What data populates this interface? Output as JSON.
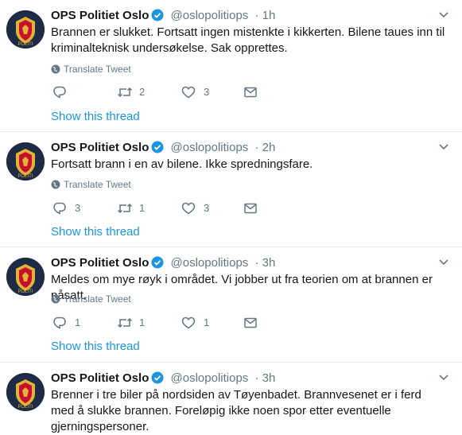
{
  "tweets": [
    {
      "name": "OPS Politiet Oslo",
      "handle": "@oslopolitiops",
      "time": "· 1h",
      "text": "Brannen er slukket. Fortsatt ingen mistenkte i kikkerten. Bilene taues inn til kriminalteknisk undersøkelse. Sak opprettes.",
      "translate": "Translate Tweet",
      "replies": "",
      "retweets": "2",
      "likes": "3",
      "show_thread": "Show this thread"
    },
    {
      "name": "OPS Politiet Oslo",
      "handle": "@oslopolitiops",
      "time": "· 2h",
      "text": "Fortsatt brann i en av bilene. Ikke spredningsfare.",
      "translate": "Translate Tweet",
      "replies": "3",
      "retweets": "1",
      "likes": "3",
      "show_thread": "Show this thread"
    },
    {
      "name": "OPS Politiet Oslo",
      "handle": "@oslopolitiops",
      "time": "· 3h",
      "text": "Meldes om mye røyk i området. Vi jobber ut fra teorien om at brannen er påsatt.",
      "translate": "Translate Tweet",
      "replies": "1",
      "retweets": "1",
      "likes": "1",
      "show_thread": "Show this thread"
    },
    {
      "name": "OPS Politiet Oslo",
      "handle": "@oslopolitiops",
      "time": "· 3h",
      "text": "Brenner i tre biler på nordsiden av Tøyenbadet. Brannvesenet er i ferd med å slukke brannen. Foreløpig ikke noen spor etter eventuelle gjerningspersoner."
    }
  ],
  "colors": {
    "link": "#1b95e0",
    "secondary": "#657786",
    "divider": "#e6ecf0",
    "avatar_bg": "#1d2b45",
    "badge_gold": "#e0b43a",
    "badge_red": "#c8102e"
  }
}
